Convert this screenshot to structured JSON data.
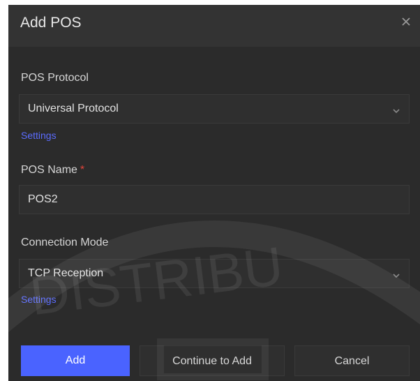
{
  "dialog": {
    "title": "Add POS",
    "close_icon": "close-icon"
  },
  "pos_protocol": {
    "label": "POS Protocol",
    "value": "Universal Protocol",
    "settings_link": "Settings"
  },
  "pos_name": {
    "label": "POS Name",
    "required_mark": "*",
    "value": "POS2"
  },
  "connection_mode": {
    "label": "Connection Mode",
    "value": "TCP Reception",
    "settings_link": "Settings"
  },
  "buttons": {
    "add": "Add",
    "continue": "Continue to Add",
    "cancel": "Cancel"
  },
  "watermark": {
    "text": "DISTRIBU"
  },
  "colors": {
    "accent": "#4a63ff",
    "link": "#5b6cff",
    "background": "#2b2b2b",
    "required": "#e0443a"
  }
}
